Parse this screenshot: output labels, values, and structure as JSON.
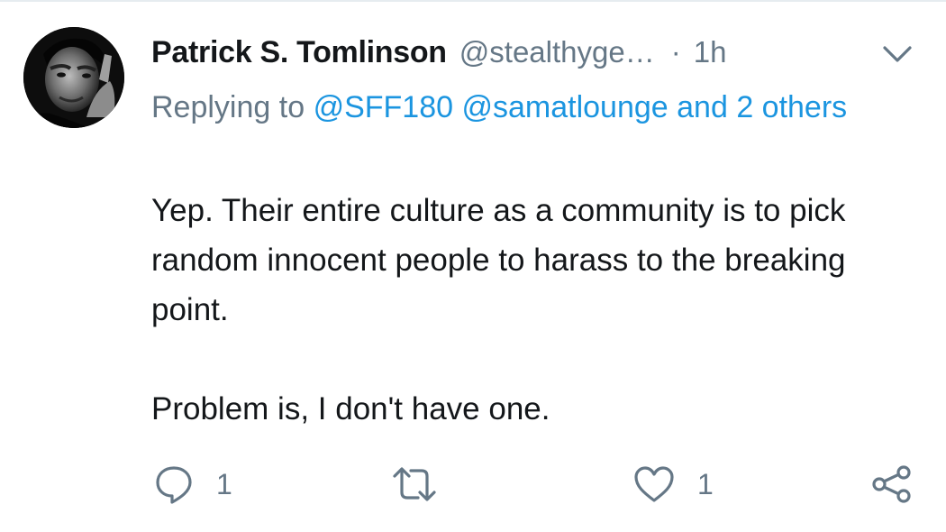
{
  "tweet": {
    "author_name": "Patrick S. Tomlinson",
    "author_handle": "@stealthyge…",
    "separator": "·",
    "time": "1h",
    "reply": {
      "prefix": "Replying to",
      "mention_1": "@SFF180",
      "mention_2": "@samatlounge",
      "others": "and 2 others"
    },
    "text_paragraph_1": "Yep. Their entire culture as a community is to pick random innocent people to harass to the breaking point.",
    "text_paragraph_2": "Problem is, I don't have one.",
    "actions": {
      "reply_count": "1",
      "like_count": "1"
    }
  },
  "icons": {
    "menu": "chevron-down-icon",
    "reply": "speech-bubble-icon",
    "retweet": "retweet-icon",
    "like": "heart-icon",
    "share": "share-icon"
  },
  "colors": {
    "text": "#14171a",
    "secondary": "#657786",
    "link": "#1b95e0",
    "divider": "#e6ecf0"
  }
}
